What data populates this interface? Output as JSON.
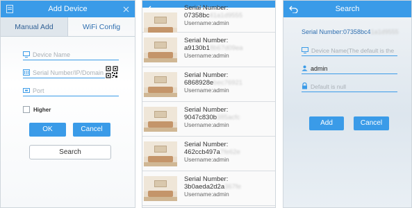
{
  "colors": {
    "accent": "#3a9be8",
    "link": "#2f6fb0"
  },
  "add_device": {
    "title": "Add Device",
    "tabs": [
      {
        "label": "Manual Add"
      },
      {
        "label": "WiFi Config"
      }
    ],
    "device_name_placeholder": "Device Name",
    "serial_placeholder": "Serial Number/IP/Domain N",
    "port_placeholder": "Port",
    "higher_label": "Higher",
    "ok_label": "OK",
    "cancel_label": "Cancel",
    "search_label": "Search"
  },
  "search": {
    "title": "Search",
    "devices": [
      {
        "label": "Serial Number:",
        "serial": "07358bc",
        "serial_masked": "41a1d9555",
        "username": "Username:admin"
      },
      {
        "label": "Serial Number:",
        "serial": "a9130b1",
        "serial_masked": "8b67d09ea",
        "username": "Username:admin"
      },
      {
        "label": "Serial Number:",
        "serial": "6868928e",
        "serial_masked": "bec76921",
        "username": "Username:admin"
      },
      {
        "label": "Serial Number:",
        "serial": "9047c830b",
        "serial_masked": "385acfc",
        "username": "Username:admin"
      },
      {
        "label": "Serial Number:",
        "serial": "462ccb497a",
        "serial_masked": "7fe62e",
        "username": "Username:admin"
      },
      {
        "label": "Serial Number:",
        "serial": "3b0aeda2d2a",
        "serial_masked": "367fe",
        "username": "Username:admin"
      }
    ]
  },
  "detail": {
    "title": "Search",
    "serial_label": "Serial Number:07358bc4",
    "serial_masked": "1a1d9555",
    "device_name_placeholder": "Device Name(The default is the",
    "username_value": "admin",
    "password_placeholder": "Default is null",
    "add_label": "Add",
    "cancel_label": "Cancel"
  },
  "icons": [
    "menu-icon",
    "close-icon",
    "device-icon",
    "serial-icon",
    "qr-code-icon",
    "port-icon",
    "back-icon",
    "user-icon",
    "lock-icon"
  ]
}
